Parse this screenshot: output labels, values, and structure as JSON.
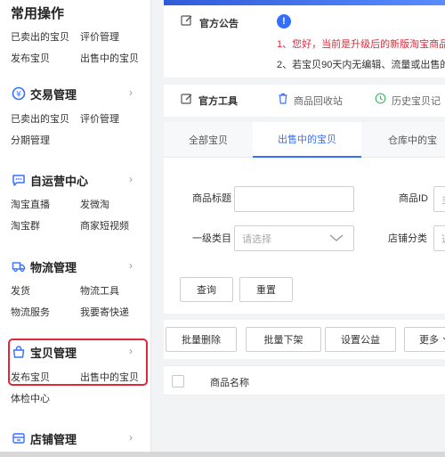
{
  "sidebar": {
    "title": "常用操作",
    "quick_links": [
      "已卖出的宝贝",
      "评价管理",
      "发布宝贝",
      "出售中的宝贝"
    ],
    "sections": [
      {
        "title": "交易管理",
        "icon": "currency-circle-icon",
        "links": [
          "已卖出的宝贝",
          "评价管理",
          "分期管理"
        ]
      },
      {
        "title": "自运营中心",
        "icon": "chat-bubble-icon",
        "links": [
          "淘宝直播",
          "发微淘",
          "淘宝群",
          "商家短视频"
        ]
      },
      {
        "title": "物流管理",
        "icon": "truck-icon",
        "links": [
          "发货",
          "物流工具",
          "物流服务",
          "我要寄快递"
        ]
      },
      {
        "title": "宝贝管理",
        "icon": "bag-icon",
        "links": [
          "发布宝贝",
          "出售中的宝贝",
          "体检中心"
        ]
      },
      {
        "title": "店铺管理",
        "icon": "store-icon",
        "links": []
      }
    ],
    "chevron": "›"
  },
  "announcement": {
    "title": "官方公告",
    "badge": "!",
    "line1": "1、您好，当前是升级后的新版淘宝商品",
    "line2": "2、若宝贝90天内无编辑、流量或出售的"
  },
  "tools": {
    "title": "官方工具",
    "items": [
      "商品回收站",
      "历史宝贝记"
    ]
  },
  "tabs": [
    "全部宝贝",
    "出售中的宝贝",
    "仓库中的宝"
  ],
  "filters": {
    "title_label": "商品标题",
    "id_label": "商品ID",
    "id_placeholder": "多",
    "category_label": "一级类目",
    "category_placeholder": "请选择",
    "shop_category_label": "店铺分类",
    "shop_category_placeholder": "选",
    "query_button": "查询",
    "reset_button": "重置"
  },
  "bulk_actions": [
    "批量删除",
    "批量下架",
    "设置公益",
    "更多"
  ],
  "table": {
    "column_name": "商品名称"
  },
  "colors": {
    "accent": "#3470ff",
    "highlight": "#e0283a"
  }
}
